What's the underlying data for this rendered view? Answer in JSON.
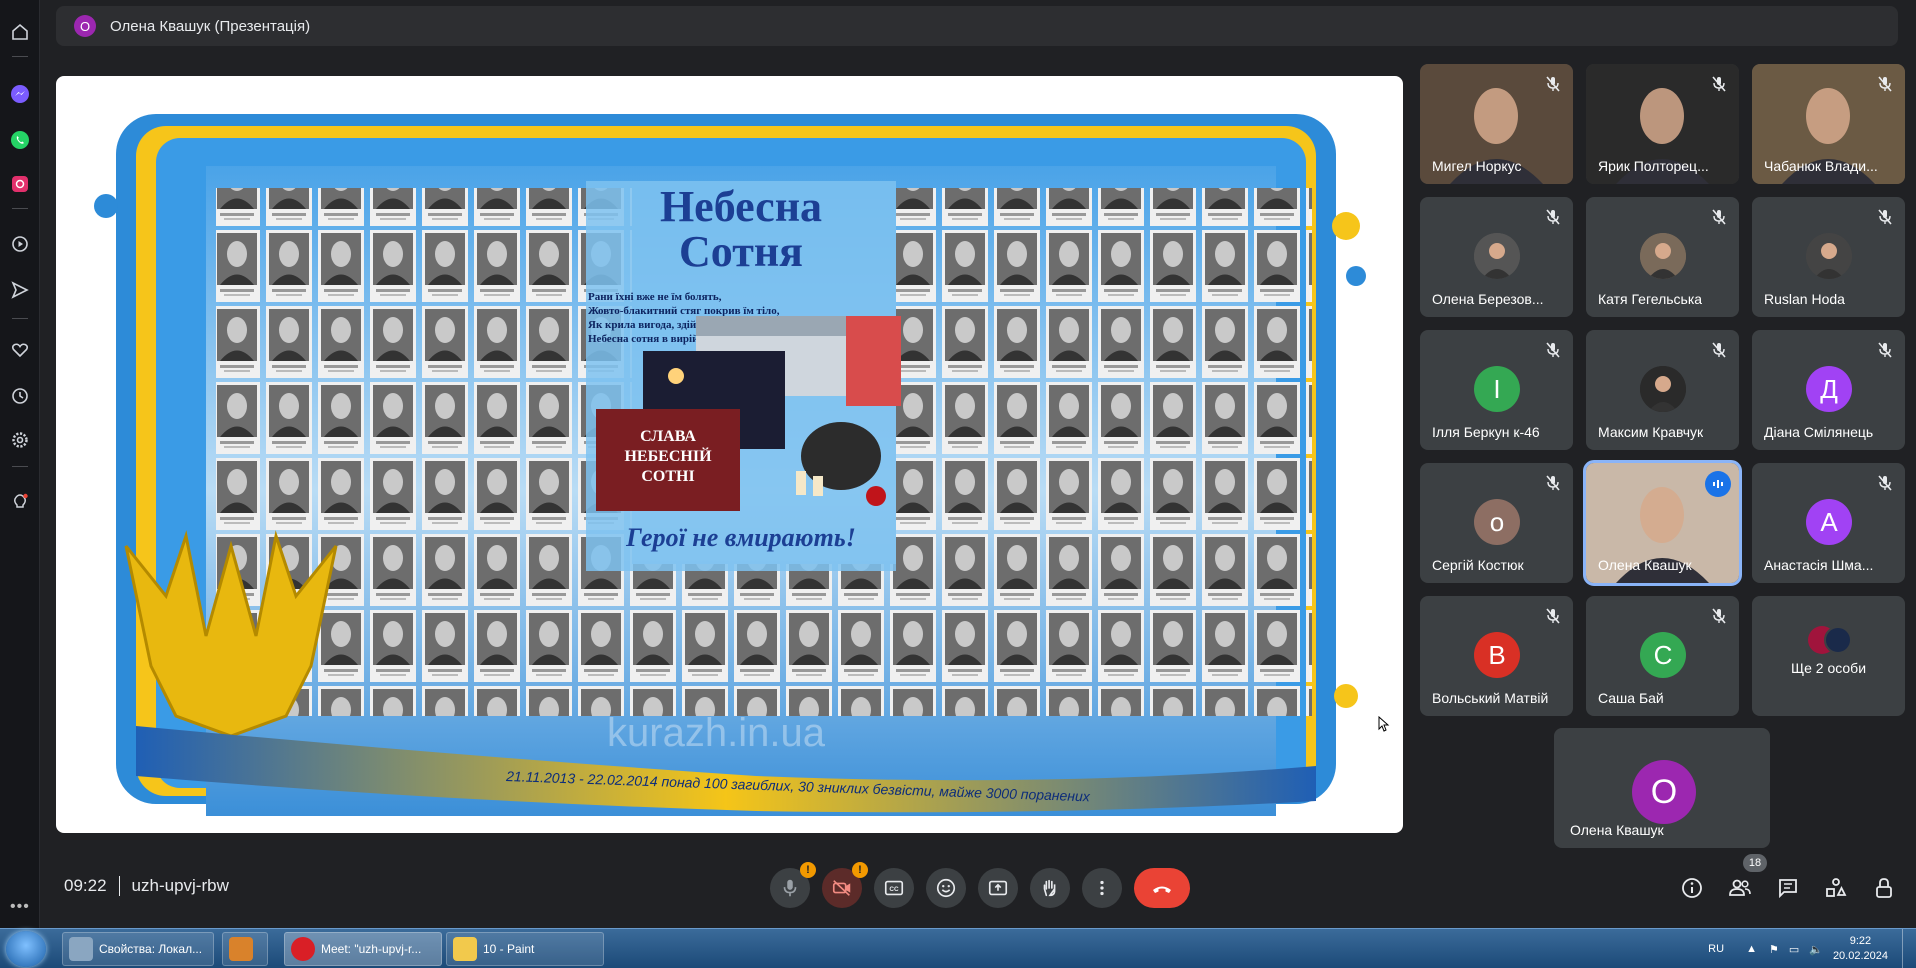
{
  "presenter_bar": {
    "avatar_letter": "О",
    "title": "Олена Квашук (Презентація)"
  },
  "presentation": {
    "heading_line1": "Небесна",
    "heading_line2": "Сотня",
    "poem": [
      "Рани їхні вже не їм болять,",
      "Жовто-блакитний стяг покрив їм тіло,",
      "Як крила вигода, здіймались вверх,",
      "Небесна сотня в вирій полетіла.."
    ],
    "wreath_text_1": "СЛАВА",
    "wreath_text_2": "НЕБЕСНІЙ",
    "wreath_text_3": "СОТНІ",
    "slogan": "Герої не вмирають!",
    "footer": "21.11.2013 - 22.02.2014 понад 100 загиблих, 30 зниклих безвісти, майже 3000 поранених",
    "watermark": "kurazh.in.ua"
  },
  "participants": [
    {
      "name": "Мигел Норкус",
      "type": "photo",
      "muted": true
    },
    {
      "name": "Ярик Полторец...",
      "type": "photo",
      "muted": true
    },
    {
      "name": "Чабанюк Влади...",
      "type": "photo",
      "muted": true
    },
    {
      "name": "Олена Березов...",
      "type": "photo-small",
      "muted": true
    },
    {
      "name": "Катя Гегельська",
      "type": "photo-small",
      "muted": true
    },
    {
      "name": "Ruslan Hoda",
      "type": "photo-small",
      "muted": true
    },
    {
      "name": "Ілля Беркун к-46",
      "type": "letter",
      "letter": "І",
      "color": "#34a853",
      "muted": true
    },
    {
      "name": "Максим Кравчук",
      "type": "photo-small",
      "muted": true
    },
    {
      "name": "Діана Смілянець",
      "type": "letter",
      "letter": "Д",
      "color": "#a142f4",
      "muted": true
    },
    {
      "name": "Сергій Костюк",
      "type": "letter",
      "letter": "о",
      "color": "#8d6e63",
      "muted": true
    },
    {
      "name": "Олена Квашук",
      "type": "photo",
      "muted": false,
      "speaking": true
    },
    {
      "name": "Анастасія Шма...",
      "type": "letter",
      "letter": "А",
      "color": "#a142f4",
      "muted": true
    },
    {
      "name": "Вольський Матвій",
      "type": "letter",
      "letter": "В",
      "color": "#d93025",
      "muted": true
    },
    {
      "name": "Саша Бай",
      "type": "letter",
      "letter": "С",
      "color": "#34a853",
      "muted": true
    },
    {
      "name": "Ще 2 особи",
      "type": "more",
      "muted": false
    }
  ],
  "self_tile": {
    "name": "Олена Квашук",
    "letter": "О",
    "color": "#9c27b0"
  },
  "meeting": {
    "time": "09:22",
    "code": "uzh-upvj-rbw"
  },
  "controls": {
    "mic_warning": "!",
    "cam_warning": "!"
  },
  "people_count": "18",
  "taskbar": {
    "items": [
      {
        "label": "Свойства: Локал...",
        "color": "#8aa6c1"
      },
      {
        "label": "",
        "color": "#d9822b"
      },
      {
        "label": "Meet: \"uzh-upvj-r...",
        "color": "#d91f26"
      },
      {
        "label": "10 - Paint",
        "color": "#f2c94c"
      }
    ],
    "lang": "RU",
    "time": "9:22",
    "date": "20.02.2024"
  },
  "colors": {
    "accent": "#8ab4f8",
    "end_call": "#ea4335",
    "warning": "#f29900"
  }
}
